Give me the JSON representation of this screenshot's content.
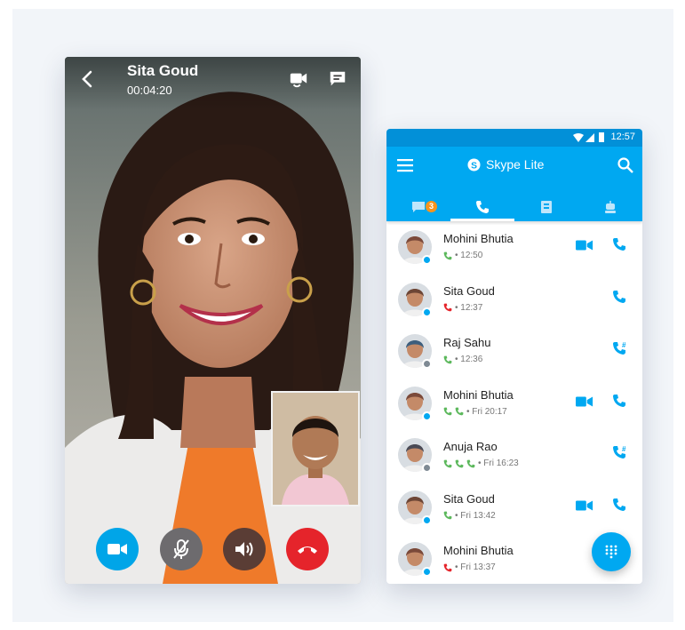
{
  "call_screen": {
    "caller_name": "Sita Goud",
    "duration": "00:04:20",
    "icons": [
      "back-arrow-icon",
      "switch-camera-icon",
      "chat-icon",
      "video-icon",
      "mic-off-icon",
      "speaker-icon",
      "hangup-icon"
    ],
    "colors": {
      "video": "#00a5e8",
      "mute": "#6d6b6e",
      "speaker": "#5a3d35",
      "hangup": "#e5242b"
    }
  },
  "phone": {
    "status_time": "12:57",
    "app_title": "Skype Lite",
    "chat_badge": "3",
    "accent": "#00a8f1",
    "tabs": [
      "chats",
      "calls",
      "contacts",
      "bots"
    ],
    "calls": [
      {
        "name": "Mohini Bhutia",
        "time": "12:50",
        "call_type": "incoming",
        "count": 1,
        "presence": "online",
        "video": true,
        "dial": false
      },
      {
        "name": "Sita Goud",
        "time": "12:37",
        "call_type": "missed",
        "count": 1,
        "presence": "online",
        "video": false,
        "dial": false
      },
      {
        "name": "Raj Sahu",
        "time": "12:36",
        "call_type": "incoming",
        "count": 1,
        "presence": "offline",
        "video": false,
        "dial": true
      },
      {
        "name": "Mohini Bhutia",
        "time": "Fri 20:17",
        "call_type": "incoming",
        "count": 2,
        "presence": "online",
        "video": true,
        "dial": false
      },
      {
        "name": "Anuja Rao",
        "time": "Fri 16:23",
        "call_type": "incoming",
        "count": 3,
        "presence": "offline",
        "video": false,
        "dial": true
      },
      {
        "name": "Sita Goud",
        "time": "Fri 13:42",
        "call_type": "incoming",
        "count": 1,
        "presence": "online",
        "video": true,
        "dial": false
      },
      {
        "name": "Mohini Bhutia",
        "time": "Fri 13:37",
        "call_type": "missed",
        "count": 1,
        "presence": "online",
        "video": false,
        "dial": false
      }
    ]
  }
}
